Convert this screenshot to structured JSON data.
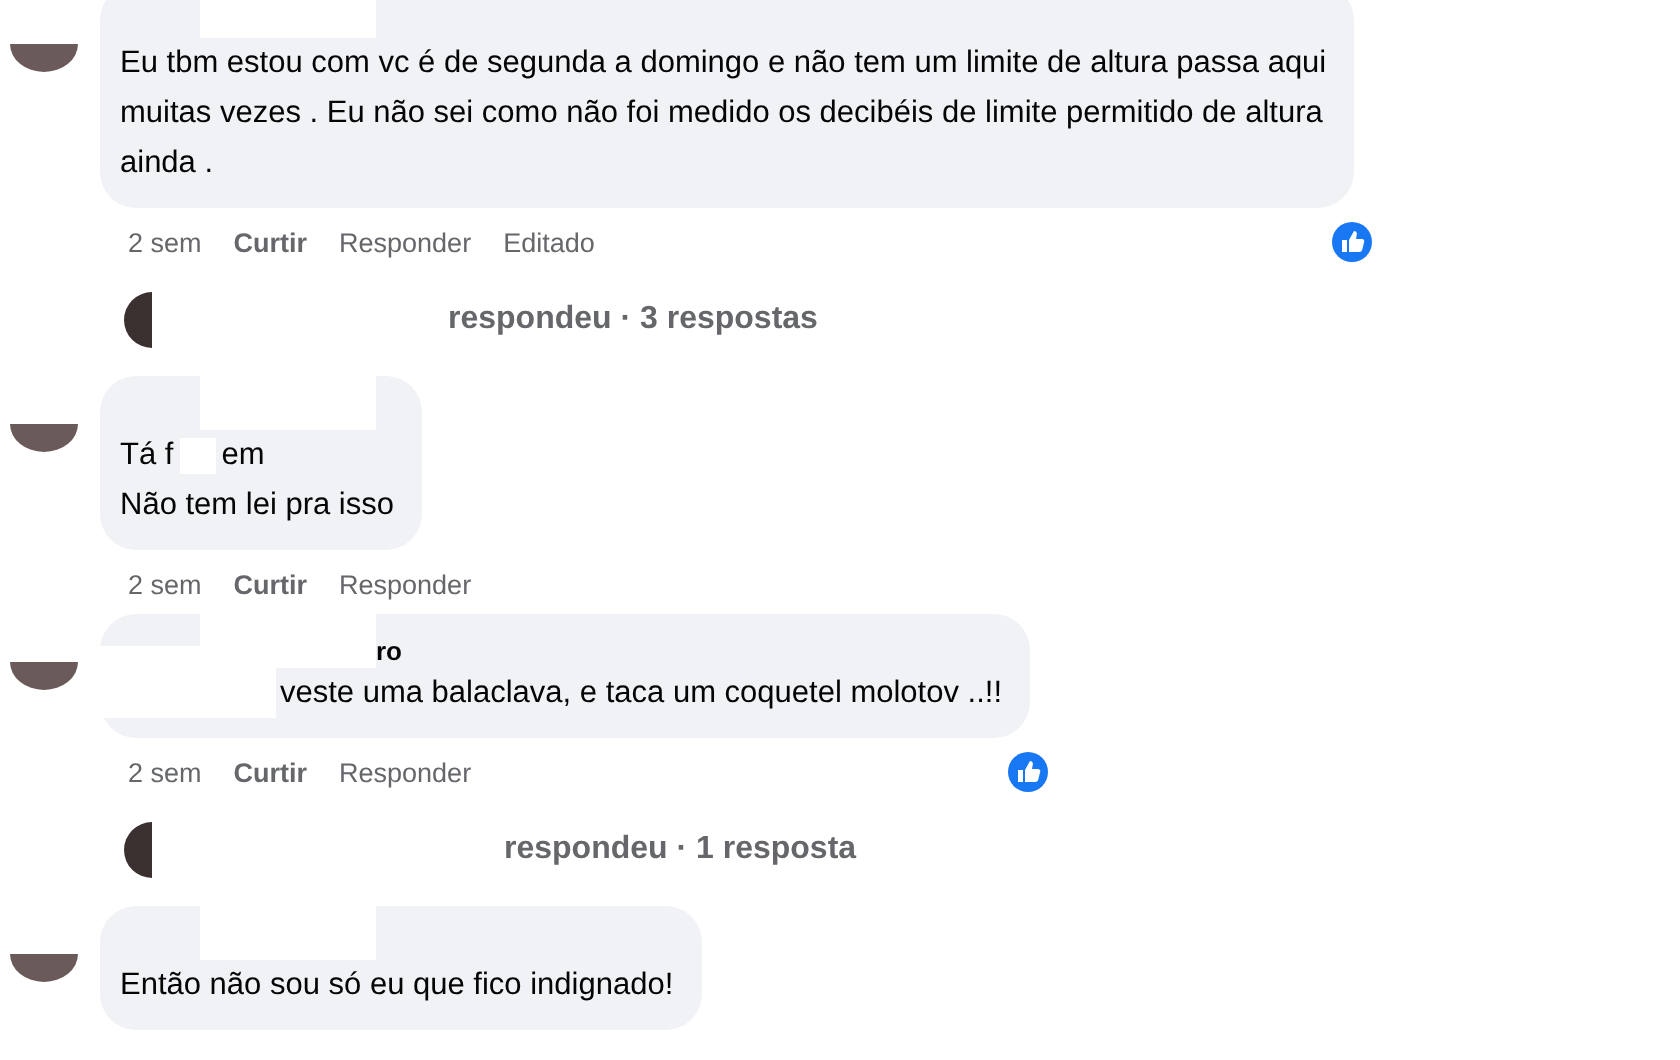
{
  "comments": [
    {
      "name": [
        {
          "kind": "redacted"
        }
      ],
      "lines": [
        [
          {
            "kind": "text",
            "text": "Eu tbm estou com vc é de segunda a domingo e não tem um limite de altura passa aqui"
          }
        ],
        [
          {
            "kind": "text",
            "text": "muitas vezes . Eu não sei como não foi medido os decibéis de limite permitido de altura"
          }
        ],
        [
          {
            "kind": "text",
            "text": "ainda ."
          }
        ]
      ],
      "time": "2 sem",
      "like_label": "Curtir",
      "reply_label": "Responder",
      "edited_label": "Editado",
      "liked": true,
      "replies": {
        "text": "respondeu · 3 respostas"
      }
    },
    {
      "name": [
        {
          "kind": "redacted"
        }
      ],
      "lines": [
        [
          {
            "kind": "text",
            "text": "Tá f"
          },
          {
            "kind": "redacted"
          },
          {
            "kind": "text",
            "text": "em"
          }
        ],
        [
          {
            "kind": "text",
            "text": "Não tem lei pra isso"
          }
        ]
      ],
      "time": "2 sem",
      "like_label": "Curtir",
      "reply_label": "Responder",
      "liked": false
    },
    {
      "name": [
        {
          "kind": "redacted"
        },
        {
          "kind": "text",
          "text": "ro"
        }
      ],
      "lines": [
        [
          {
            "kind": "redacted"
          },
          {
            "kind": "text",
            "text": "veste uma balaclava, e taca um coquetel molotov ..!!"
          }
        ]
      ],
      "time": "2 sem",
      "like_label": "Curtir",
      "reply_label": "Responder",
      "liked": true,
      "replies": {
        "text": "respondeu · 1 resposta"
      }
    },
    {
      "name": [
        {
          "kind": "redacted"
        }
      ],
      "lines": [
        [
          {
            "kind": "text",
            "text": "Então não sou só eu que fico indignado!"
          }
        ]
      ],
      "liked": false
    }
  ]
}
